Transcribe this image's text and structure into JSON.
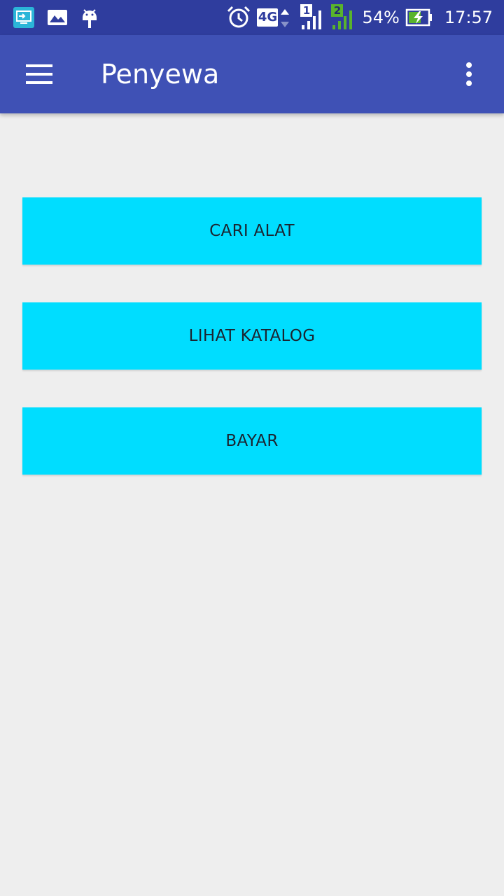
{
  "status_bar": {
    "battery_percent": "54%",
    "time": "17:57",
    "network_type": "4G",
    "sim1_label": "1",
    "sim2_label": "2",
    "icons": [
      "screen-mirror-icon",
      "gallery-icon",
      "android-debug-icon",
      "alarm-icon",
      "network-4g-icon",
      "signal-sim1-icon",
      "signal-sim2-icon",
      "battery-charging-icon"
    ]
  },
  "app_bar": {
    "title": "Penyewa",
    "menu_icon": "hamburger-menu-icon",
    "overflow_icon": "more-vert-icon",
    "color": "#3f51b5"
  },
  "buttons": [
    {
      "label": "CARI ALAT"
    },
    {
      "label": "LIHAT KATALOG"
    },
    {
      "label": "BAYAR"
    }
  ],
  "colors": {
    "status_bar": "#2f3d9e",
    "app_bar": "#3f51b5",
    "button_bg": "#00ddff",
    "background": "#eeeeee"
  }
}
